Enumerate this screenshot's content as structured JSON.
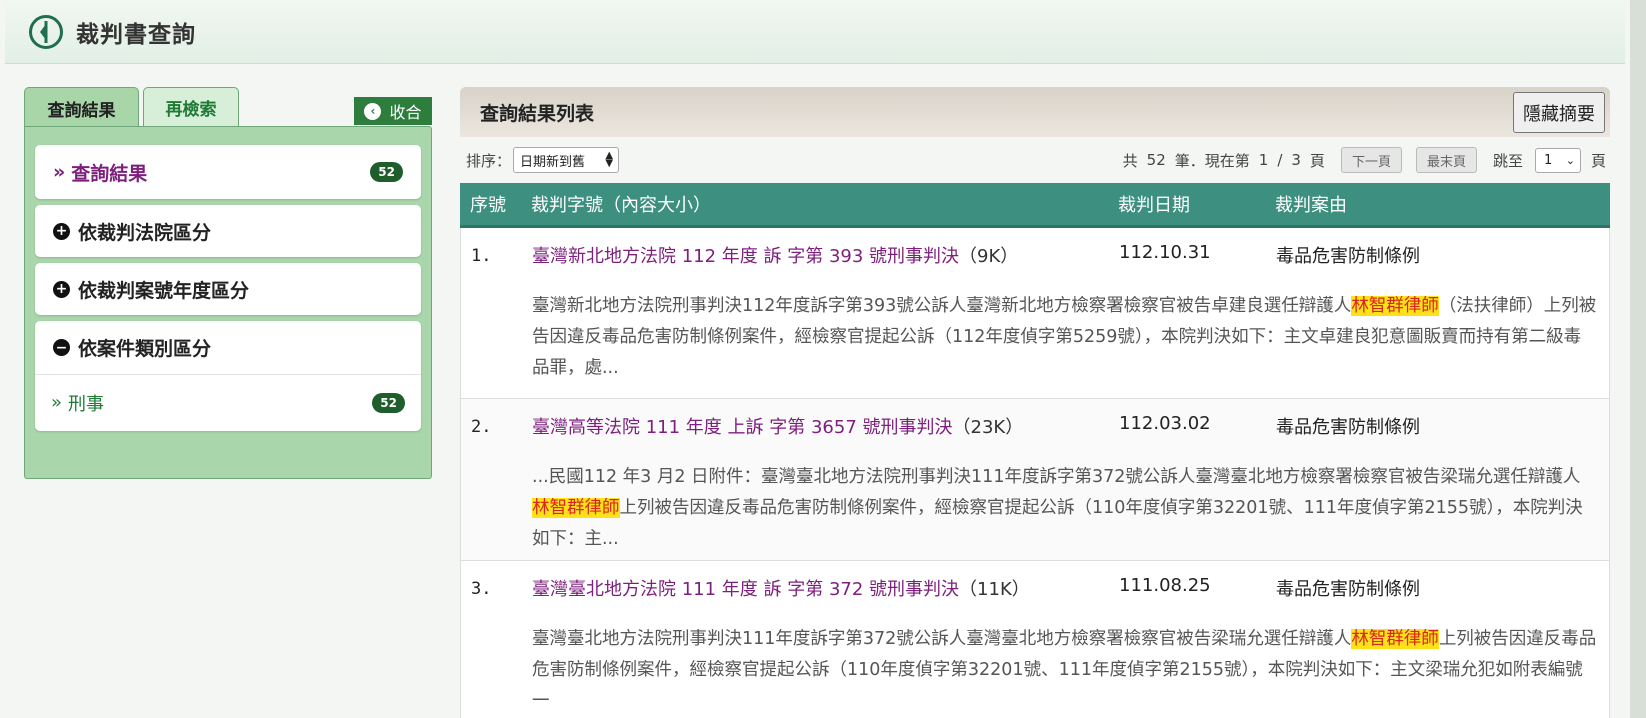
{
  "header": {
    "title": "裁判書查詢"
  },
  "left": {
    "tabs": [
      {
        "label": "查詢結果"
      },
      {
        "label": "再檢索"
      }
    ],
    "collapse_label": "收合",
    "results_item": {
      "label": "查詢結果",
      "count": "52"
    },
    "groups": [
      {
        "label": "依裁判法院區分",
        "expanded": false
      },
      {
        "label": "依裁判案號年度區分",
        "expanded": false
      },
      {
        "label": "依案件類別區分",
        "expanded": true
      }
    ],
    "category_item": {
      "label": "刑事",
      "count": "52"
    }
  },
  "right": {
    "title": "查詢結果列表",
    "hide_summary_label": "隱藏摘要",
    "sort": {
      "label": "排序：",
      "value": "日期新到舊"
    },
    "pager": {
      "total_prefix": "共",
      "total": "52",
      "total_suffix": "筆．現在第",
      "current": "1",
      "sep": "/",
      "pages": "3",
      "page_suffix": "頁",
      "next_label": "下一頁",
      "last_label": "最末頁",
      "jump_label": "跳至",
      "jump_value": "1",
      "jump_suffix": "頁"
    },
    "columns": {
      "no": "序號",
      "id": "裁判字號（內容大小）",
      "date": "裁判日期",
      "reason": "裁判案由"
    },
    "rows": [
      {
        "no": "1.",
        "title": "臺灣新北地方法院 112 年度 訴 字第 393 號刑事判決",
        "size": "（9K）",
        "date": "112.10.31",
        "reason": "毒品危害防制條例",
        "summary_before": "臺灣新北地方法院刑事判決112年度訴字第393號公訴人臺灣新北地方檢察署檢察官被告卓建良選任辯護人",
        "highlight": "林智群律師",
        "summary_after": "（法扶律師）上列被告因違反毒品危害防制條例案件，經檢察官提起公訴（112年度偵字第5259號），本院判決如下：主文卓建良犯意圖販賣而持有第二級毒品罪，處..."
      },
      {
        "no": "2.",
        "title": "臺灣高等法院 111 年度 上訴 字第 3657 號刑事判決",
        "size": "（23K）",
        "date": "112.03.02",
        "reason": "毒品危害防制條例",
        "summary_before": "...民國112 年3 月2 日附件：臺灣臺北地方法院刑事判決111年度訴字第372號公訴人臺灣臺北地方檢察署檢察官被告梁瑞允選任辯護人",
        "highlight": "林智群律師",
        "summary_after": "上列被告因違反毒品危害防制條例案件，經檢察官提起公訴（110年度偵字第32201號、111年度偵字第2155號），本院判決如下：主..."
      },
      {
        "no": "3.",
        "title": "臺灣臺北地方法院 111 年度 訴 字第 372 號刑事判決",
        "size": "（11K）",
        "date": "111.08.25",
        "reason": "毒品危害防制條例",
        "summary_before": "臺灣臺北地方法院刑事判決111年度訴字第372號公訴人臺灣臺北地方檢察署檢察官被告梁瑞允選任辯護人",
        "highlight": "林智群律師",
        "summary_after": "上列被告因違反毒品危害防制條例案件，經檢察官提起公訴（110年度偵字第32201號、111年度偵字第2155號），本院判決如下：主文梁瑞允犯如附表編號一"
      }
    ]
  }
}
